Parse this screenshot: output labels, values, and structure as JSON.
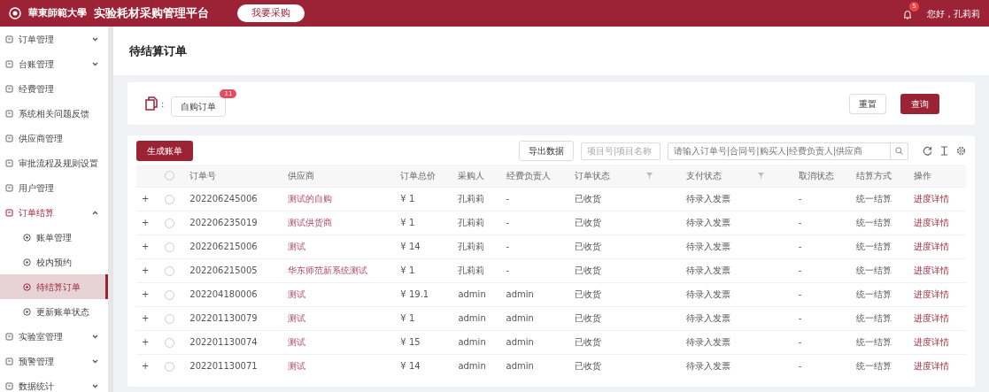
{
  "header": {
    "logo_text": "華東師範大學",
    "title": "实验耗材采购管理平台",
    "action_button": "我要采购",
    "notification_count": "5",
    "greeting": "您好，孔莉莉"
  },
  "sidebar": {
    "items": [
      {
        "label": "订单管理",
        "expanded": false
      },
      {
        "label": "台账管理",
        "expanded": false
      },
      {
        "label": "经费管理"
      },
      {
        "label": "系统相关问题反馈"
      },
      {
        "label": "供应商管理"
      },
      {
        "label": "审批流程及规则设置"
      },
      {
        "label": "用户管理"
      },
      {
        "label": "订单结算",
        "expanded": true,
        "children": [
          {
            "label": "账单管理",
            "selected": false
          },
          {
            "label": "校内预约",
            "selected": false
          },
          {
            "label": "待结算订单",
            "selected": true
          },
          {
            "label": "更新账单状态",
            "selected": false
          }
        ]
      },
      {
        "label": "实验室管理",
        "expanded": false
      },
      {
        "label": "预警管理",
        "expanded": false
      },
      {
        "label": "数据统计",
        "expanded": false
      }
    ]
  },
  "page_title": "待结算订单",
  "filter": {
    "separator": ":",
    "tag": "自购订单",
    "tag_count": "11",
    "buttons": [
      "重置",
      "查询"
    ]
  },
  "toolbar": {
    "primary_button": "生成账单",
    "export_button": "导出数据",
    "project_placeholder": "项目号|项目名称",
    "search_placeholder": "请输入订单号|合同号|购买人|经费负责人|供应商"
  },
  "table": {
    "select_all_checked": false,
    "columns": [
      {
        "label": "订单号"
      },
      {
        "label": "供应商"
      },
      {
        "label": "订单总价"
      },
      {
        "label": "采购人"
      },
      {
        "label": "经费负责人"
      },
      {
        "label": "订单状态",
        "filter": true
      },
      {
        "label": "支付状态",
        "filter": true
      },
      {
        "label": "取消状态"
      },
      {
        "label": "结算方式"
      },
      {
        "label": "操作"
      }
    ],
    "rows": [
      {
        "expand": "+",
        "checked": false,
        "cells": [
          "202206245006",
          "测试的自购",
          "¥ 1",
          "孔莉莉",
          "-",
          "已收货",
          "待录入发票",
          "-",
          "统一结算",
          "进度详情"
        ]
      },
      {
        "expand": "+",
        "checked": false,
        "cells": [
          "202206235019",
          "测试供货商",
          "¥ 1",
          "孔莉莉",
          "-",
          "已收货",
          "待录入发票",
          "-",
          "统一结算",
          "进度详情"
        ]
      },
      {
        "expand": "+",
        "checked": false,
        "cells": [
          "202206215006",
          "测试",
          "¥ 14",
          "孔莉莉",
          "-",
          "已收货",
          "待录入发票",
          "-",
          "统一结算",
          "进度详情"
        ]
      },
      {
        "expand": "+",
        "checked": false,
        "cells": [
          "202206215005",
          "华东师范新系统测试",
          "¥ 1",
          "孔莉莉",
          "-",
          "已收货",
          "待录入发票",
          "-",
          "统一结算",
          "进度详情"
        ]
      },
      {
        "expand": "+",
        "checked": false,
        "cells": [
          "202204180006",
          "测试",
          "¥ 19.1",
          "admin",
          "admin",
          "已收货",
          "待录入发票",
          "-",
          "统一结算",
          "进度详情"
        ]
      },
      {
        "expand": "+",
        "checked": false,
        "cells": [
          "202201130079",
          "测试",
          "¥ 1",
          "admin",
          "admin",
          "已收货",
          "待录入发票",
          "-",
          "统一结算",
          "进度详情"
        ]
      },
      {
        "expand": "+",
        "checked": false,
        "cells": [
          "202201130074",
          "测试",
          "¥ 15",
          "admin",
          "admin",
          "已收货",
          "待录入发票",
          "-",
          "统一结算",
          "进度详情"
        ]
      },
      {
        "expand": "+",
        "checked": false,
        "cells": [
          "202201130071",
          "测试",
          "¥ 14",
          "admin",
          "admin",
          "已收货",
          "待录入发票",
          "-",
          "统一结算",
          "进度详情"
        ]
      }
    ]
  }
}
